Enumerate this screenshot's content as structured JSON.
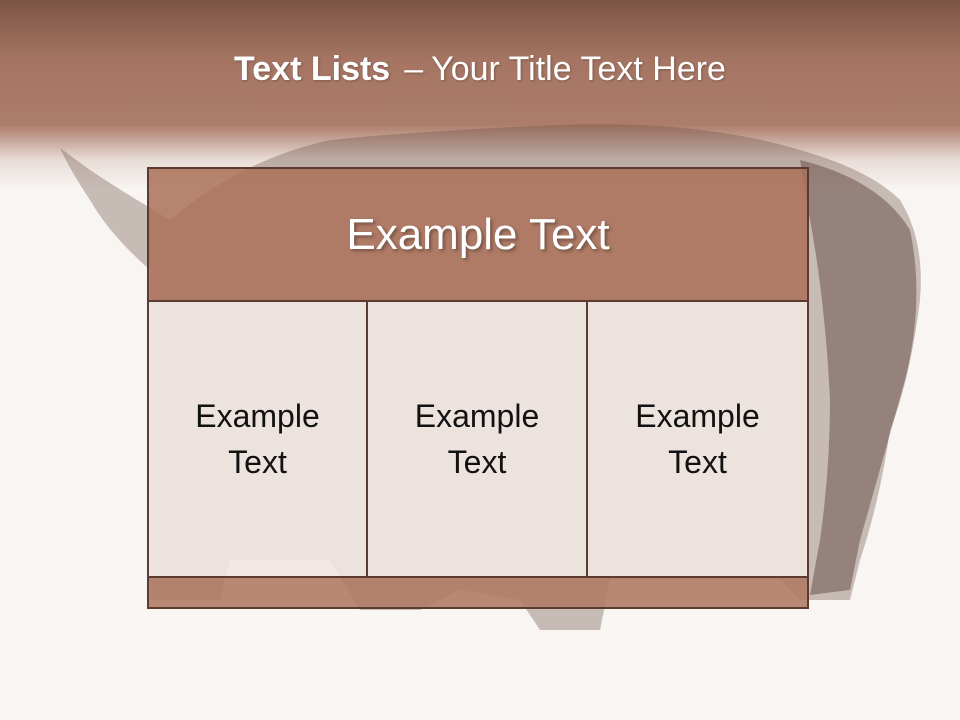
{
  "slide": {
    "title_bold": "Text Lists",
    "title_separator": "–",
    "title_rest": "Your Title Text Here",
    "header_text": "Example Text",
    "columns": [
      "Example Text",
      "Example Text",
      "Example Text"
    ]
  },
  "colors": {
    "header_brown": "#a57462",
    "border": "#5b3b30",
    "cell_fill": "#f0e6e2",
    "bar_fill": "#b07c66"
  }
}
